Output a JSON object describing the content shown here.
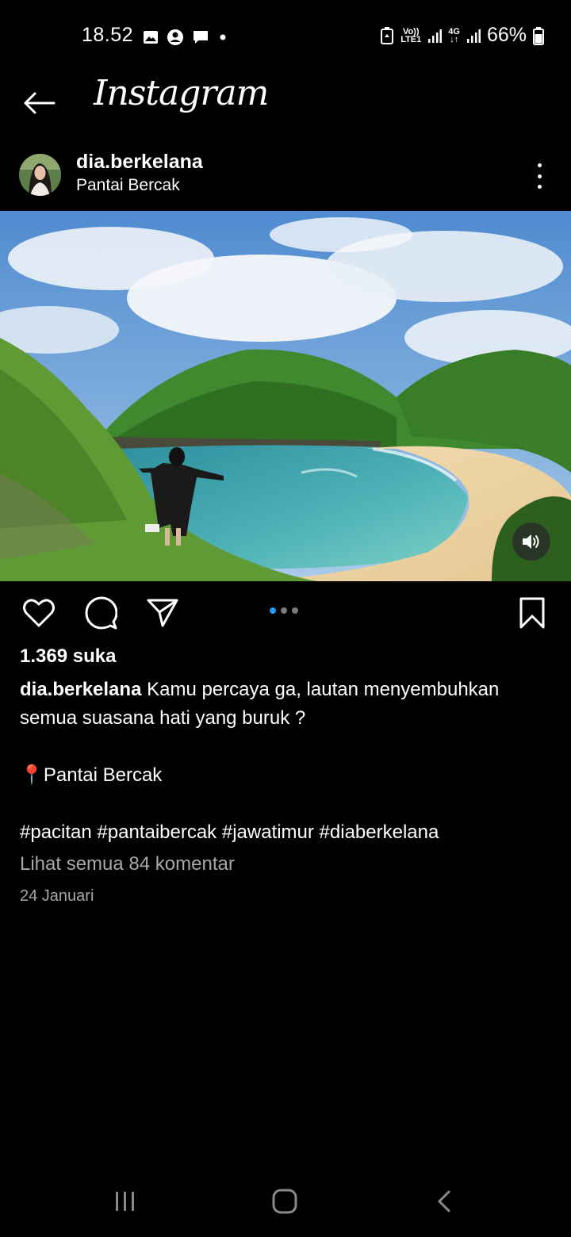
{
  "status_bar": {
    "time": "18.52",
    "battery": "66%",
    "net_label_top": "Vo))",
    "net_label_bottom": "LTE1",
    "net_type": "4G"
  },
  "header": {
    "app_name": "Instagram"
  },
  "post": {
    "username": "dia.berkelana",
    "location": "Pantai Bercak",
    "likes": "1.369 suka",
    "caption_user": "dia.berkelana",
    "caption_line1": " Kamu percaya ga, lautan menyembuhkan semua suasana hati yang buruk ?",
    "caption_location": "📍Pantai Bercak",
    "caption_tags": "#pacitan #pantaibercak #jawatimur #diaberkelana",
    "comments_link": "Lihat semua 84 komentar",
    "date": "24 Januari",
    "carousel_total": 3,
    "carousel_active": 1
  },
  "colors": {
    "background": "#000000",
    "accent_dot": "#1d9bf0",
    "secondary_text": "#a8a8a8"
  }
}
